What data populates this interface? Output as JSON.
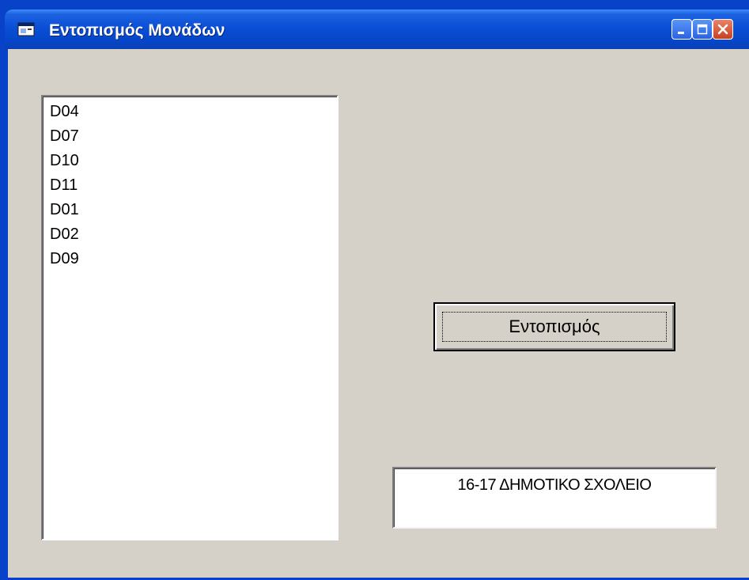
{
  "window": {
    "title": "Εντοπισμός Μονάδων",
    "app_icon": "form-icon",
    "caption_buttons": {
      "minimize": "minimize-icon",
      "maximize": "maximize-icon",
      "close": "close-icon"
    }
  },
  "listbox": {
    "items": [
      "D04",
      "D07",
      "D10",
      "D11",
      "D01",
      "D02",
      "D09"
    ]
  },
  "locate_button": {
    "label": "Εντοπισμός"
  },
  "result": {
    "value": "16-17 ΔΗΜΟΤΙΚΟ ΣΧΟΛΕΙΟ"
  },
  "colors": {
    "titlebar": "#0a4fd6",
    "client_background": "#d5d1c9",
    "close_button": "#c8401f"
  }
}
